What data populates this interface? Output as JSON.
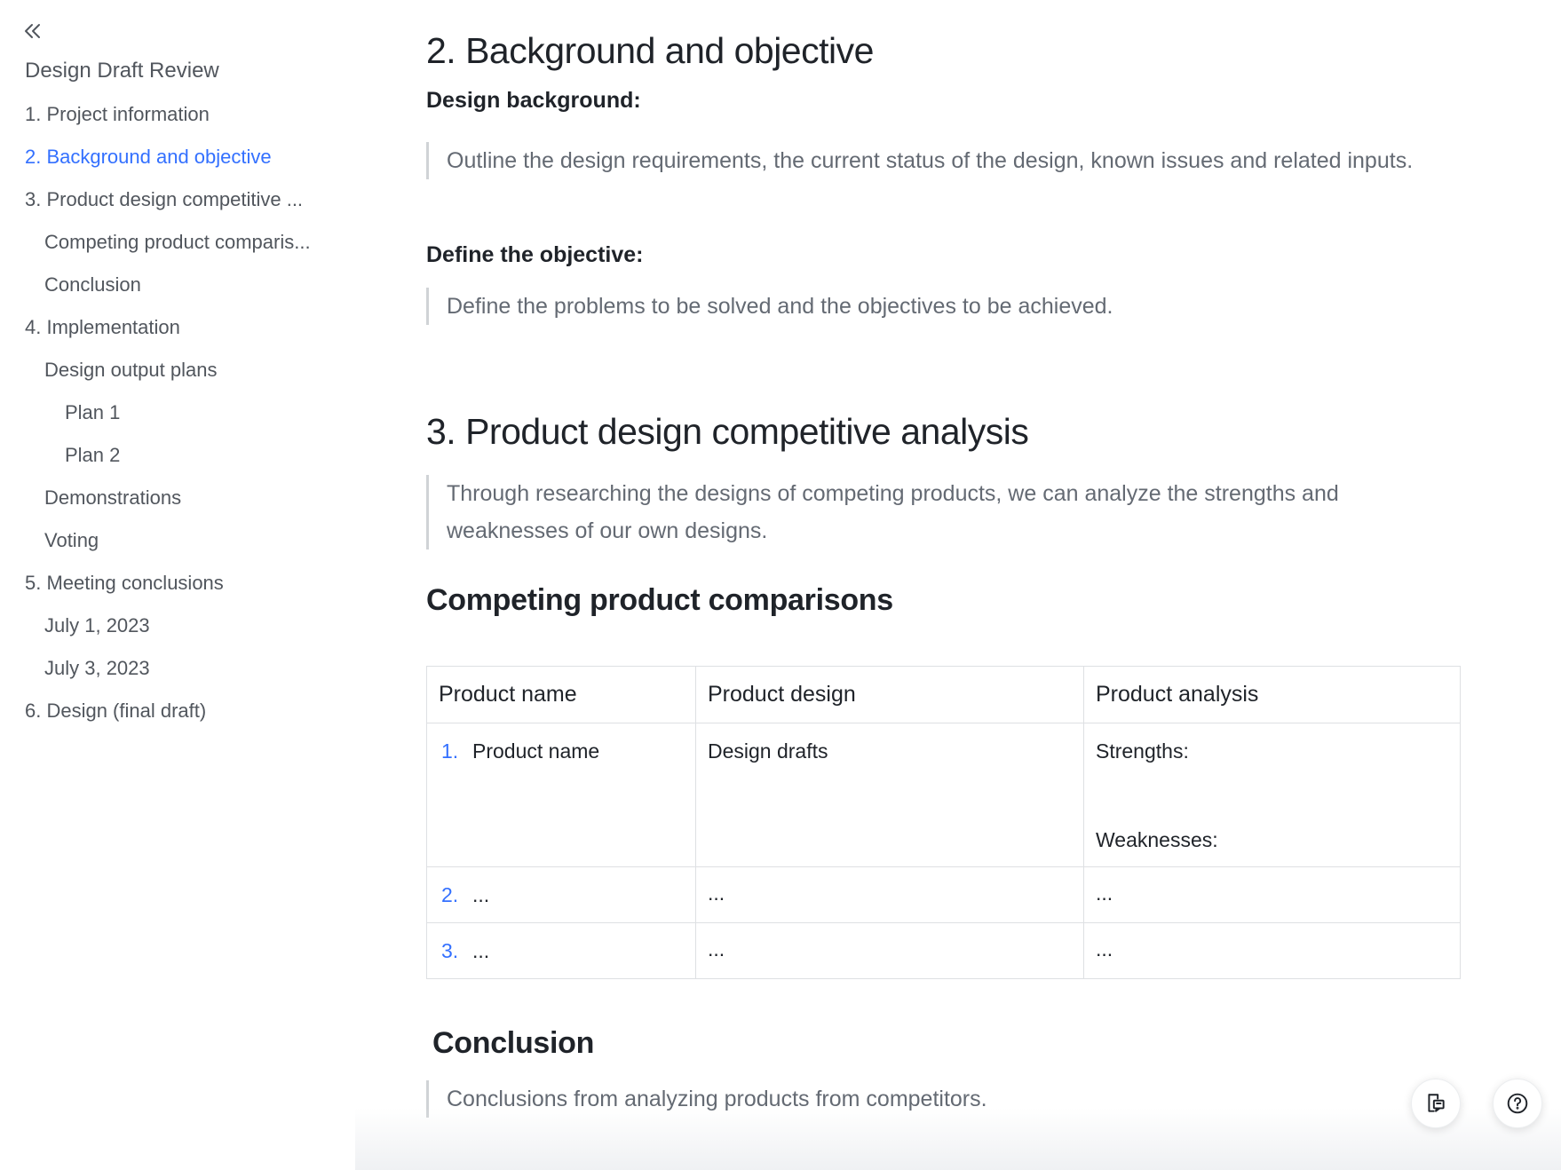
{
  "sidebar": {
    "title": "Design Draft Review",
    "items": [
      {
        "label": "1. Project information",
        "level": 1,
        "active": false
      },
      {
        "label": "2. Background and objective",
        "level": 1,
        "active": true
      },
      {
        "label": "3. Product design competitive ...",
        "level": 1,
        "active": false
      },
      {
        "label": "Competing product comparis...",
        "level": 2,
        "active": false
      },
      {
        "label": "Conclusion",
        "level": 2,
        "active": false
      },
      {
        "label": "4. Implementation",
        "level": 1,
        "active": false
      },
      {
        "label": "Design output plans",
        "level": 2,
        "active": false
      },
      {
        "label": "Plan 1",
        "level": 3,
        "active": false
      },
      {
        "label": "Plan 2",
        "level": 3,
        "active": false
      },
      {
        "label": "Demonstrations",
        "level": 2,
        "active": false
      },
      {
        "label": "Voting",
        "level": 2,
        "active": false
      },
      {
        "label": "5. Meeting conclusions",
        "level": 1,
        "active": false
      },
      {
        "label": "July 1, 2023",
        "level": 2,
        "active": false
      },
      {
        "label": "July 3, 2023",
        "level": 2,
        "active": false
      },
      {
        "label": "6. Design (final draft)",
        "level": 1,
        "active": false
      }
    ]
  },
  "doc": {
    "section2": {
      "heading": "2. Background and objective",
      "background_label": "Design background:",
      "background_text": "Outline the design requirements, the current status of the design, known issues and related inputs.",
      "objective_label": "Define the objective:",
      "objective_text": "Define the problems to be solved and the objectives to be achieved."
    },
    "section3": {
      "heading": "3. Product design competitive analysis",
      "intro": "Through researching the designs of competing products, we can analyze the strengths and weaknesses of our own designs.",
      "comparisons_heading": "Competing product comparisons",
      "table": {
        "headers": [
          "Product name",
          "Product design",
          "Product analysis"
        ],
        "rows": [
          {
            "num": "1.",
            "name": "Product name",
            "design": "Design drafts",
            "strengths": "Strengths:",
            "weaknesses": "Weaknesses:"
          },
          {
            "num": "2.",
            "name": "...",
            "design": "...",
            "analysis": "..."
          },
          {
            "num": "3.",
            "name": "...",
            "design": "...",
            "analysis": "..."
          }
        ]
      },
      "conclusion_heading": "Conclusion",
      "conclusion_text": "Conclusions from analyzing products from competitors."
    }
  },
  "icons": {
    "collapse": "double-chevron-left-icon",
    "comments": "comment-panel-icon",
    "help": "help-icon"
  },
  "colors": {
    "accent": "#3370ff",
    "text": "#1f2329",
    "muted": "#646a73"
  }
}
